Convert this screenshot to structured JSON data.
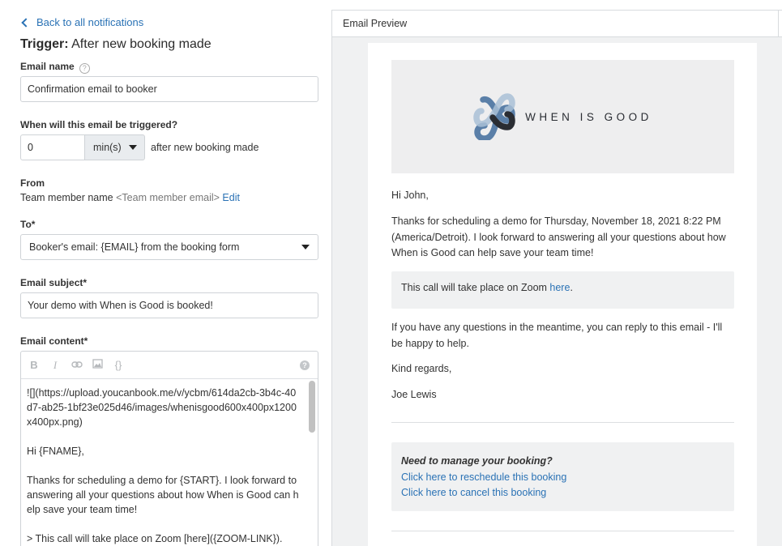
{
  "nav": {
    "back_label": "Back to all notifications"
  },
  "trigger": {
    "label": "Trigger:",
    "value": "After new booking made"
  },
  "email_name": {
    "label": "Email name",
    "value": "Confirmation email to booker"
  },
  "timing": {
    "label": "When will this email be triggered?",
    "value": "0",
    "unit": "min(s)",
    "suffix": "after new booking made"
  },
  "from": {
    "label": "From",
    "name": "Team member name",
    "email": "<Team member email>",
    "edit_label": "Edit"
  },
  "to": {
    "label": "To*",
    "selected": "Booker's email: {EMAIL} from the booking form"
  },
  "subject": {
    "label": "Email subject*",
    "value": "Your demo with When is Good is booked!"
  },
  "content": {
    "label": "Email content*",
    "toolbar": {
      "bold": "B",
      "italic": "I",
      "link": "⊂⊃",
      "image": "▣",
      "code": "{}",
      "help": "?"
    },
    "body": "![](https://upload.youcanbook.me/v/ycbm/614da2cb-3b4c-40d7-ab25-1bf23e025d46/images/whenisgood600x400px1200x400px.png)\n\nHi {FNAME},\n\nThanks for scheduling a demo for {START}. I look forward to answering all your questions about how When is Good can help save your team time!\n\n> This call will take place on Zoom [here]({ZOOM-LINK})."
  },
  "preview": {
    "header": "Email Preview",
    "logo_text": "WHEN IS GOOD",
    "greeting": "Hi John,",
    "para1": "Thanks for scheduling a demo for Thursday, November 18, 2021 8:22 PM (America/Detroit). I look forward to answering all your questions about how When is Good can help save your team time!",
    "zoom_text": "This call will take place on Zoom ",
    "zoom_link": "here",
    "zoom_end": ".",
    "para2": "If you have any questions in the meantime, you can reply to this email - I'll be happy to help.",
    "closing": "Kind regards,",
    "signature": "Joe Lewis",
    "manage_title": "Need to manage your booking?",
    "reschedule_link": "Click here to reschedule this booking",
    "cancel_link": "Click here to cancel this booking"
  },
  "colors": {
    "link": "#2a72b5",
    "logo_dark": "#2a2d33",
    "logo_blue": "#5a7fa8",
    "logo_light": "#a9bfd6"
  }
}
